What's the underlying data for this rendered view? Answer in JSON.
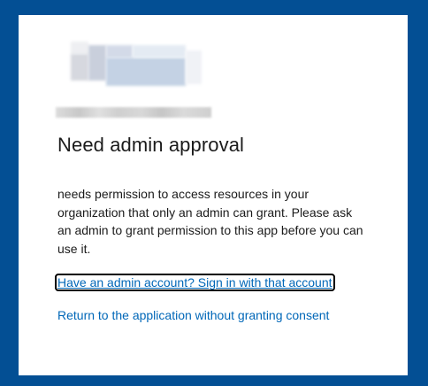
{
  "dialog": {
    "title": "Need admin approval",
    "message": "needs permission to access resources in your organization that only an admin can grant. Please ask an admin to grant permission to this app before you can use it.",
    "links": {
      "admin_signin": "Have an admin account? Sign in with that account",
      "return_without_consent": "Return to the application without granting consent"
    }
  },
  "colors": {
    "background": "#034f94",
    "link": "#0067b8",
    "text": "#1b1b1b"
  }
}
